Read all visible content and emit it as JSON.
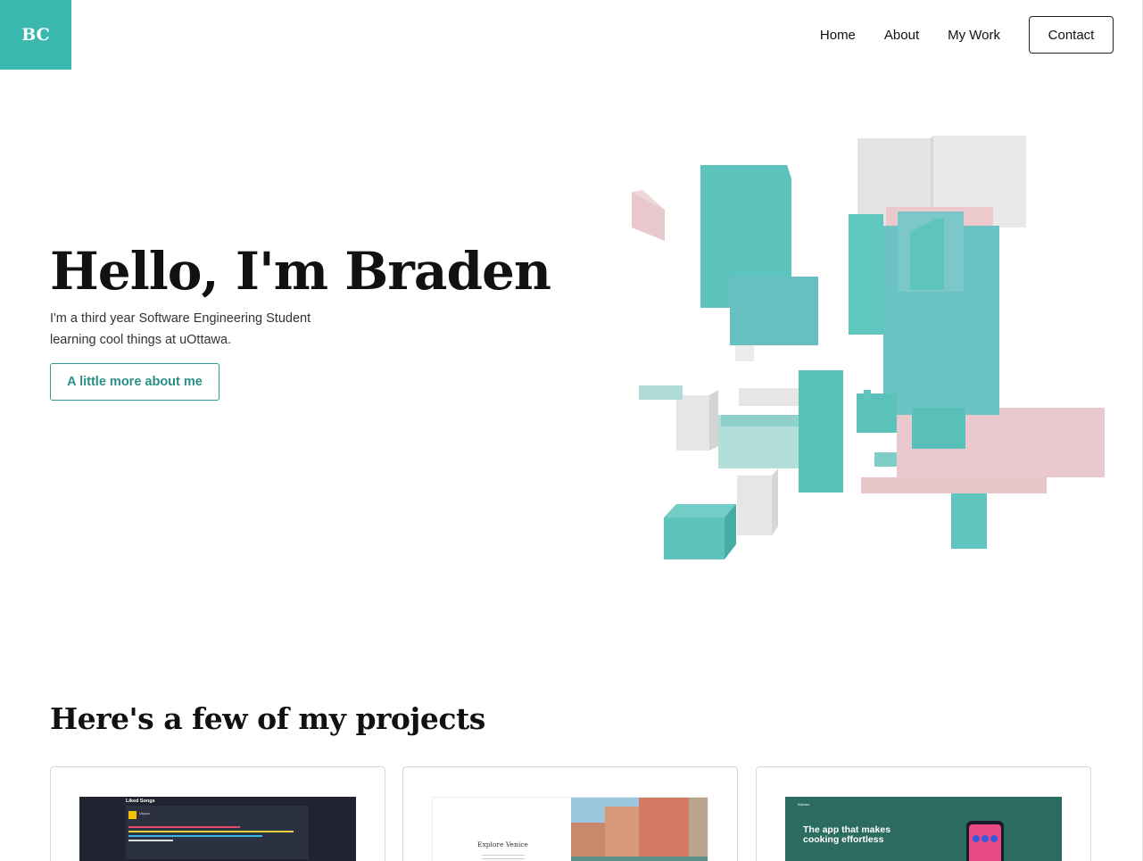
{
  "header": {
    "logo": "BC",
    "nav": {
      "home": "Home",
      "about": "About",
      "work": "My Work",
      "contact": "Contact"
    }
  },
  "hero": {
    "title": "Hello, I'm Braden",
    "subtitle_line1": "I'm a third year Software Engineering Student",
    "subtitle_line2": "learning cool things at uOttawa.",
    "button": "A little more about me"
  },
  "colors": {
    "accent": "#3bb8ae",
    "teal_block": "#5cc4bc",
    "pink_block": "#e8c8cc",
    "grey_block": "#e6e6e6"
  },
  "projects": {
    "heading": "Here's a few of my projects",
    "cards": [
      {
        "shot_title": "Liked Songs",
        "shot_song": "Utopia"
      },
      {
        "shot_title": "Explore Venice"
      },
      {
        "shot_brand": "Kitchen",
        "shot_title": "The app that makes cooking effortless"
      }
    ]
  }
}
